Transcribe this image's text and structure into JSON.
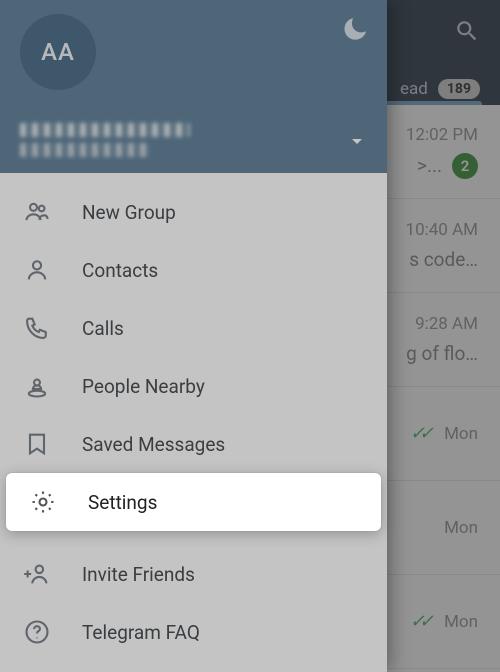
{
  "avatar_initials": "AA",
  "topbar": {
    "tab_label": "ead",
    "tab_badge": "189"
  },
  "chats": [
    {
      "time": "12:02 PM",
      "preview": ">...",
      "unread": "2",
      "checks": false
    },
    {
      "time": "10:40 AM",
      "preview": "s code…",
      "unread": null,
      "checks": false
    },
    {
      "time": "9:28 AM",
      "preview": "g of flo…",
      "unread": null,
      "checks": false
    },
    {
      "time": "Mon",
      "preview": "",
      "unread": null,
      "checks": true
    },
    {
      "time": "Mon",
      "preview": "",
      "unread": null,
      "checks": false
    },
    {
      "time": "Mon",
      "preview": "",
      "unread": null,
      "checks": true
    }
  ],
  "menu": {
    "new_group": "New Group",
    "contacts": "Contacts",
    "calls": "Calls",
    "people_nearby": "People Nearby",
    "saved_messages": "Saved Messages",
    "settings": "Settings",
    "invite_friends": "Invite Friends",
    "telegram_faq": "Telegram FAQ"
  }
}
